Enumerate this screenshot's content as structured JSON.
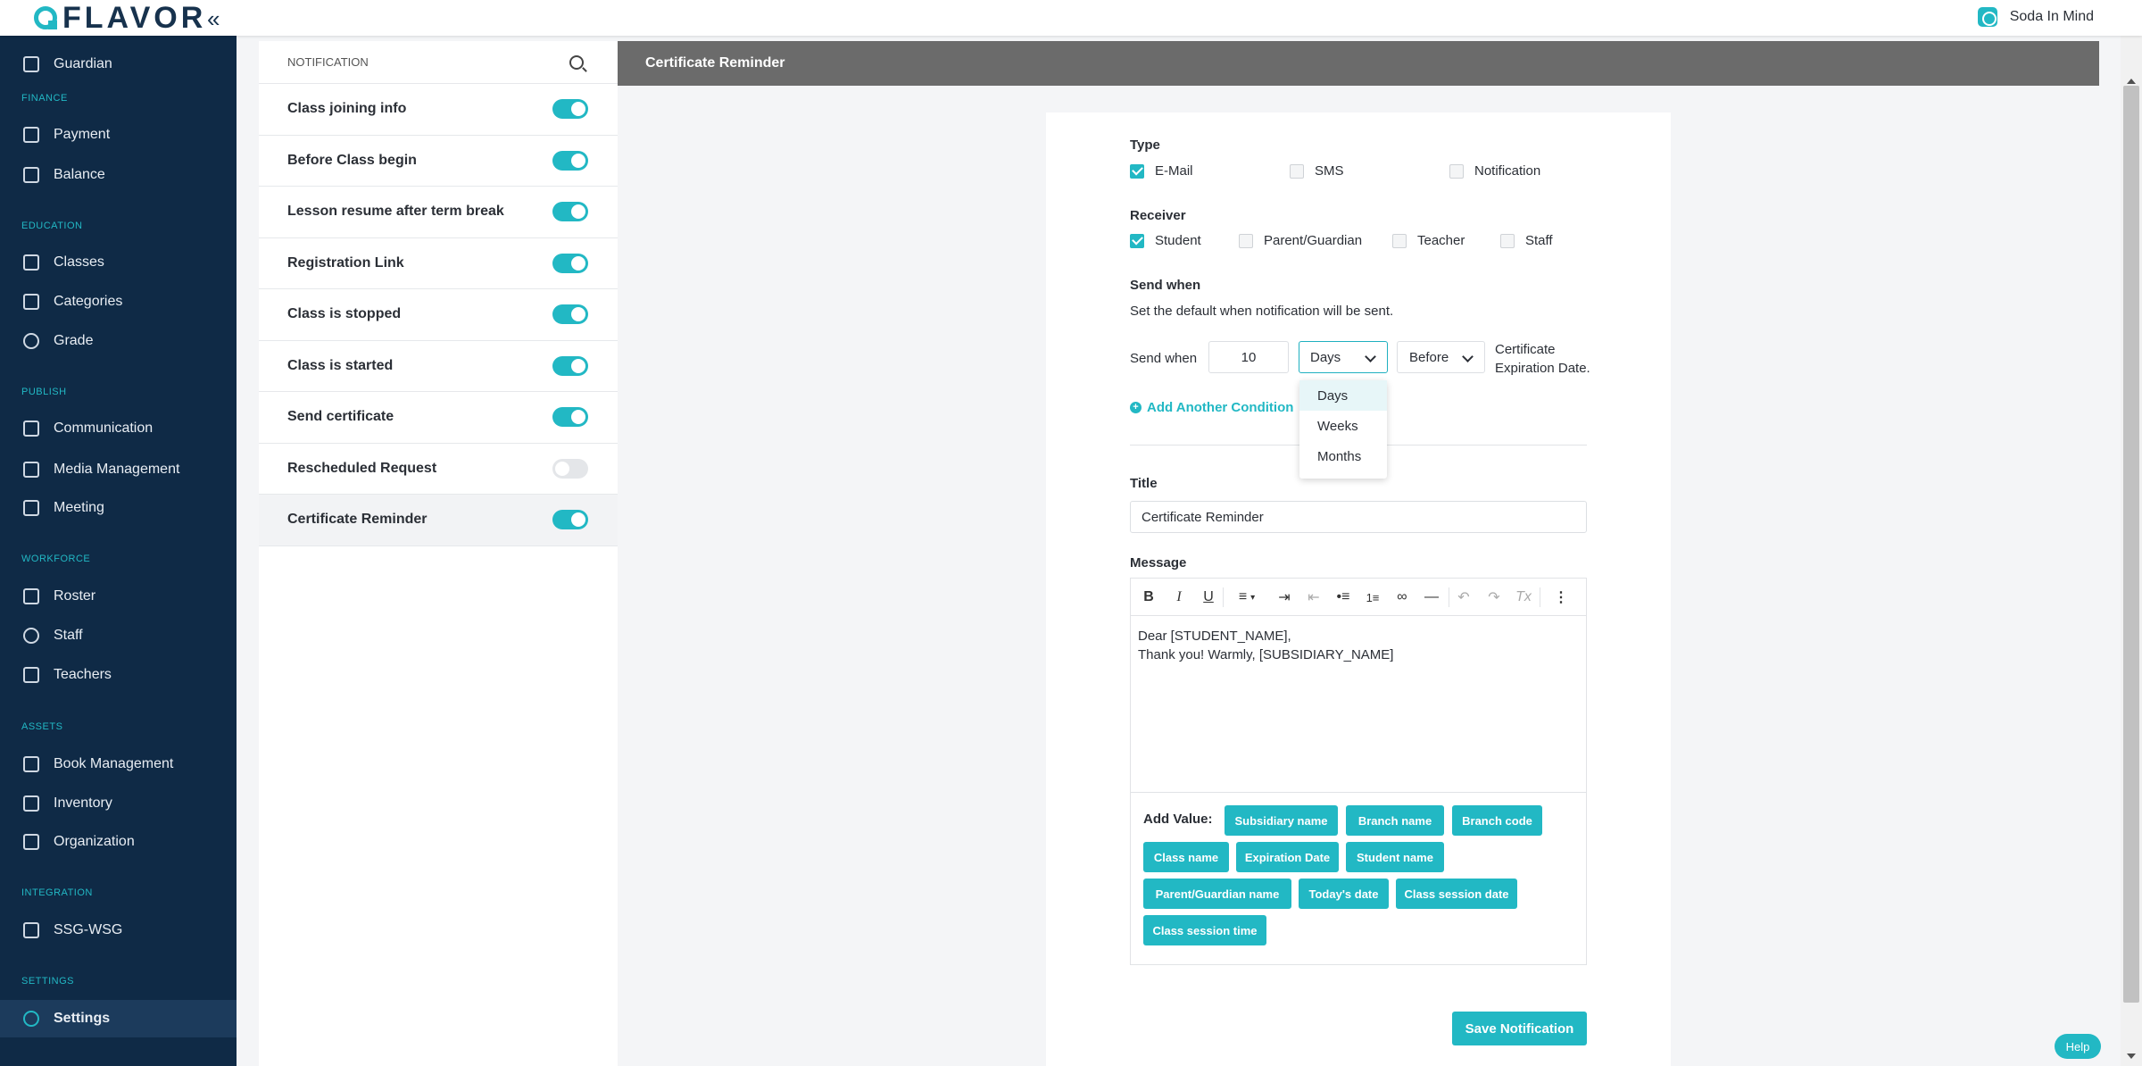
{
  "brand": {
    "logo_text": "FLAVOR",
    "collapse": "«"
  },
  "header": {
    "org_name": "Soda In Mind"
  },
  "sidebar": {
    "sections": {
      "finance": "FINANCE",
      "education": "EDUCATION",
      "publish": "PUBLISH",
      "workforce": "WORKFORCE",
      "assets": "ASSETS",
      "integration": "INTEGRATION",
      "settings": "SETTINGS"
    },
    "items": {
      "guardian": "Guardian",
      "payment": "Payment",
      "balance": "Balance",
      "classes": "Classes",
      "categories": "Categories",
      "grade": "Grade",
      "communication": "Communication",
      "media": "Media Management",
      "meeting": "Meeting",
      "roster": "Roster",
      "staff": "Staff",
      "teachers": "Teachers",
      "book": "Book Management",
      "inventory": "Inventory",
      "organization": "Organization",
      "ssg": "SSG-WSG",
      "settings": "Settings"
    }
  },
  "notifications": {
    "header": "NOTIFICATION",
    "items": [
      {
        "label": "Class joining info",
        "enabled": true
      },
      {
        "label": "Before Class begin",
        "enabled": true
      },
      {
        "label": "Lesson resume after term break",
        "enabled": true
      },
      {
        "label": "Registration Link",
        "enabled": true
      },
      {
        "label": "Class is stopped",
        "enabled": true
      },
      {
        "label": "Class is started",
        "enabled": true
      },
      {
        "label": "Send certificate",
        "enabled": true
      },
      {
        "label": "Rescheduled Request",
        "enabled": false
      },
      {
        "label": "Certificate Reminder",
        "enabled": true
      }
    ]
  },
  "panel": {
    "title": "Certificate Reminder"
  },
  "form": {
    "type_label": "Type",
    "types": {
      "email": "E-Mail",
      "sms": "SMS",
      "notification": "Notification"
    },
    "receiver_label": "Receiver",
    "receivers": {
      "student": "Student",
      "parent": "Parent/Guardian",
      "teacher": "Teacher",
      "staff": "Staff"
    },
    "send_when_label": "Send when",
    "send_when_desc": "Set the default when notification will be sent.",
    "send_when_inline": "Send when",
    "amount": "10",
    "unit_selected": "Days",
    "unit_options": [
      "Days",
      "Weeks",
      "Months"
    ],
    "relation": "Before",
    "target_line1": "Certificate",
    "target_line2": "Expiration Date.",
    "add_condition": "Add Another Condition",
    "title_label": "Title",
    "title_value": "Certificate Reminder",
    "message_label": "Message",
    "message_line1": "Dear [STUDENT_NAME],",
    "message_line2": "Thank you! Warmly, [SUBSIDIARY_NAME]",
    "add_value_label": "Add Value:",
    "chips": [
      "Subsidiary name",
      "Branch name",
      "Branch code",
      "Class name",
      "Expiration Date",
      "Student name",
      "Parent/Guardian name",
      "Today's date",
      "Class session date",
      "Class session time"
    ],
    "save_label": "Save Notification"
  },
  "toolbar": {
    "bold": "B",
    "italic": "I",
    "underline": "U",
    "align": "≡",
    "more": "⋮"
  },
  "help_label": "Help",
  "colors": {
    "accent": "#22b8c4",
    "sidebar": "#0f2a46",
    "panel_header": "#6b6b6b"
  }
}
